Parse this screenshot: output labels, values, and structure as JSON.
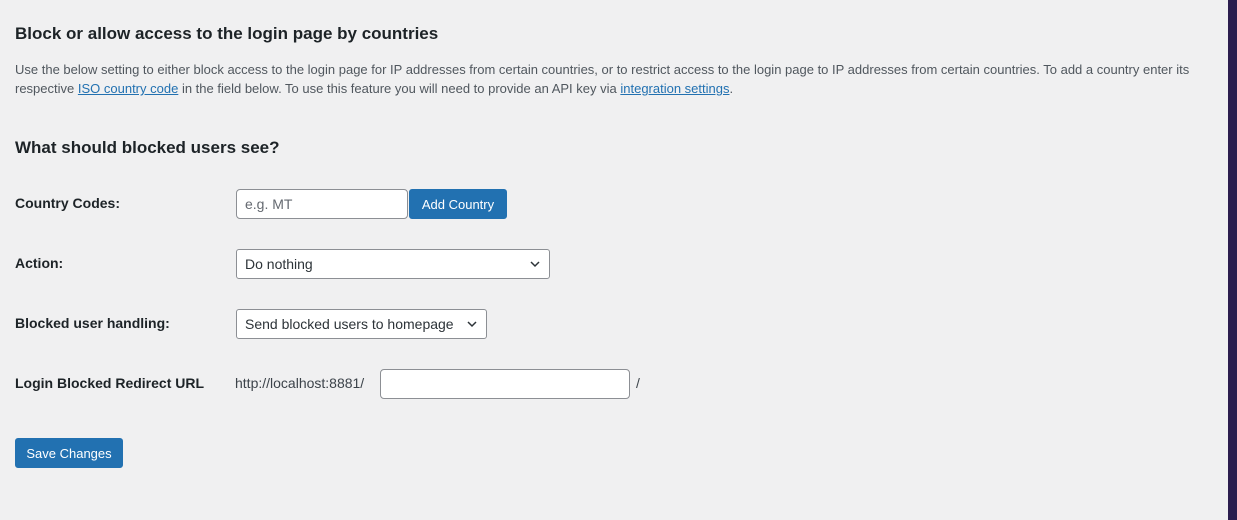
{
  "section": {
    "title": "Block or allow access to the login page by countries",
    "description_part1": "Use the below setting to either block access to the login page for IP addresses from certain countries, or to restrict access to the login page to IP addresses from certain countries. To add a country enter its respective ",
    "iso_link": "ISO country code",
    "description_part2": " in the field below. To use this feature you will need to provide an API key via ",
    "integration_link": "integration settings",
    "description_part3": "."
  },
  "subheading": "What should blocked users see?",
  "country_codes": {
    "label": "Country Codes:",
    "placeholder": "e.g. MT",
    "value": "",
    "add_button": "Add Country"
  },
  "action": {
    "label": "Action:",
    "selected": "Do nothing"
  },
  "blocked_handling": {
    "label": "Blocked user handling:",
    "selected": "Send blocked users to homepage"
  },
  "redirect": {
    "label": "Login Blocked Redirect URL",
    "prefix": "http://localhost:8881/",
    "value": "",
    "suffix": "/"
  },
  "save_button": "Save Changes",
  "icons": {
    "chevron": "chevron-down-icon"
  },
  "colors": {
    "accent": "#2271b1",
    "background": "#f0f0f1",
    "edge_strip": "#2b1d4e"
  }
}
